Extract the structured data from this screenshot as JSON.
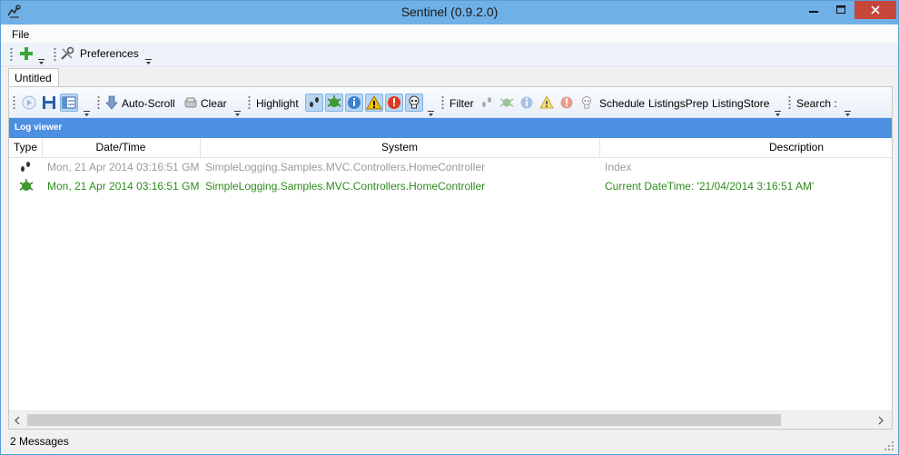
{
  "window": {
    "title": "Sentinel (0.9.2.0)"
  },
  "menu": {
    "file": "File"
  },
  "main_toolbar": {
    "preferences": "Preferences"
  },
  "tabs": [
    {
      "label": "Untitled"
    }
  ],
  "doc_toolbar": {
    "auto_scroll": "Auto-Scroll",
    "clear": "Clear",
    "highlight": "Highlight",
    "filter": "Filter",
    "schedule": "Schedule",
    "listings_prep": "ListingsPrep",
    "listing_store": "ListingStore",
    "search": "Search :"
  },
  "log_viewer": {
    "header": "Log viewer",
    "columns": [
      "Type",
      "Date/Time",
      "System",
      "Description"
    ],
    "rows": [
      {
        "type_icon": "debug-footprints-icon",
        "datetime": "Mon, 21 Apr 2014 03:16:51 GM",
        "system": "SimpleLogging.Samples.MVC.Controllers.HomeController",
        "description": "Index"
      },
      {
        "type_icon": "info-bug-icon",
        "datetime": "Mon, 21 Apr 2014 03:16:51 GM",
        "system": "SimpleLogging.Samples.MVC.Controllers.HomeController",
        "description": "Current DateTime: '21/04/2014 3:16:51 AM'"
      }
    ]
  },
  "status": {
    "text": "2 Messages"
  },
  "colors": {
    "titlebar": "#6fb0e6",
    "log_header": "#4d8fe1",
    "debug_text": "#9a9a9a",
    "info_text": "#2e8b1e",
    "close_button": "#c7463a"
  }
}
